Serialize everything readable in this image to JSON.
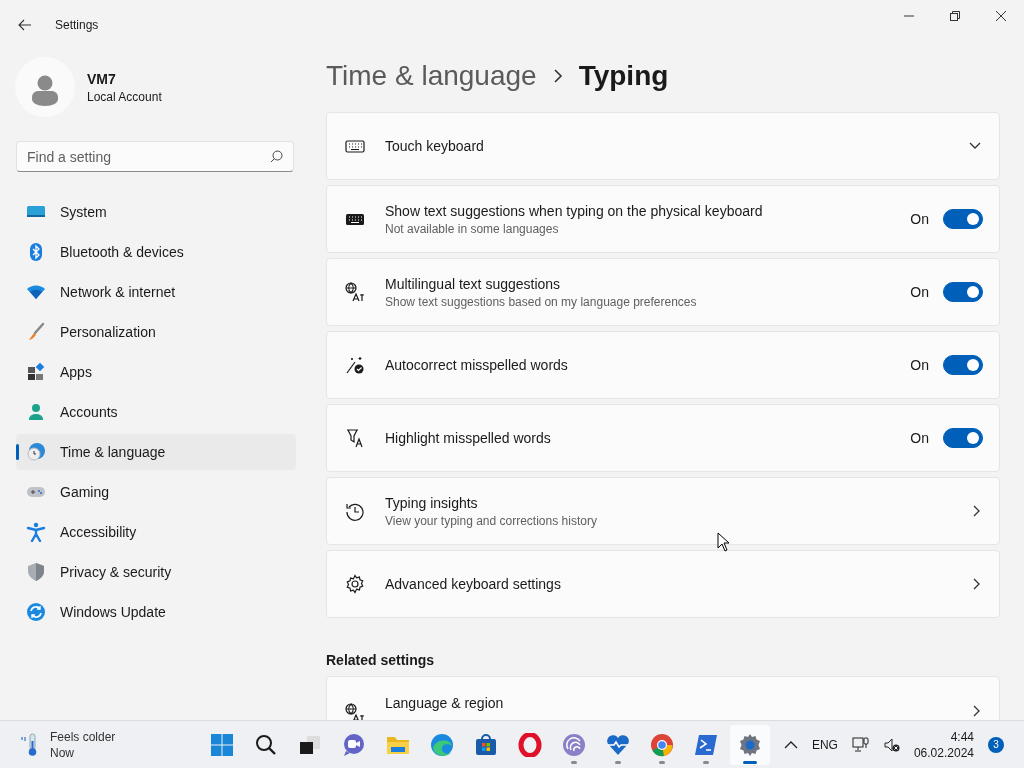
{
  "window": {
    "title": "Settings"
  },
  "profile": {
    "name": "VM7",
    "account_type": "Local Account"
  },
  "search": {
    "placeholder": "Find a setting"
  },
  "sidebar": {
    "items": [
      {
        "label": "System",
        "selected": false
      },
      {
        "label": "Bluetooth & devices",
        "selected": false
      },
      {
        "label": "Network & internet",
        "selected": false
      },
      {
        "label": "Personalization",
        "selected": false
      },
      {
        "label": "Apps",
        "selected": false
      },
      {
        "label": "Accounts",
        "selected": false
      },
      {
        "label": "Time & language",
        "selected": true
      },
      {
        "label": "Gaming",
        "selected": false
      },
      {
        "label": "Accessibility",
        "selected": false
      },
      {
        "label": "Privacy & security",
        "selected": false
      },
      {
        "label": "Windows Update",
        "selected": false
      }
    ]
  },
  "breadcrumb": {
    "parent": "Time & language",
    "current": "Typing"
  },
  "settings": [
    {
      "kind": "expander",
      "title": "Touch keyboard",
      "expanded": false
    },
    {
      "kind": "toggle",
      "title": "Show text suggestions when typing on the physical keyboard",
      "description": "Not available in some languages",
      "state_label": "On",
      "on": true
    },
    {
      "kind": "toggle",
      "title": "Multilingual text suggestions",
      "description": "Show text suggestions based on my language preferences",
      "state_label": "On",
      "on": true
    },
    {
      "kind": "toggle",
      "title": "Autocorrect misspelled words",
      "state_label": "On",
      "on": true
    },
    {
      "kind": "toggle",
      "title": "Highlight misspelled words",
      "state_label": "On",
      "on": true
    },
    {
      "kind": "link",
      "title": "Typing insights",
      "description": "View your typing and corrections history"
    },
    {
      "kind": "link",
      "title": "Advanced keyboard settings"
    }
  ],
  "related_settings": {
    "heading": "Related settings",
    "items": [
      {
        "kind": "link",
        "title": "Language & region"
      }
    ]
  },
  "taskbar": {
    "weather": {
      "condition": "Feels colder",
      "time": "Now"
    },
    "apps": [
      {
        "running": false,
        "active": false
      },
      {
        "running": false,
        "active": false
      },
      {
        "running": false,
        "active": false
      },
      {
        "running": false,
        "active": false
      },
      {
        "running": false,
        "active": false
      },
      {
        "running": false,
        "active": false
      },
      {
        "running": false,
        "active": false
      },
      {
        "running": false,
        "active": false
      },
      {
        "running": true,
        "active": false
      },
      {
        "running": true,
        "active": false
      },
      {
        "running": true,
        "active": false
      },
      {
        "running": true,
        "active": false
      },
      {
        "running": true,
        "active": true
      }
    ],
    "tray": {
      "language": "ENG",
      "time": "4:44",
      "date": "06.02.2024",
      "notification_count": "3"
    }
  }
}
